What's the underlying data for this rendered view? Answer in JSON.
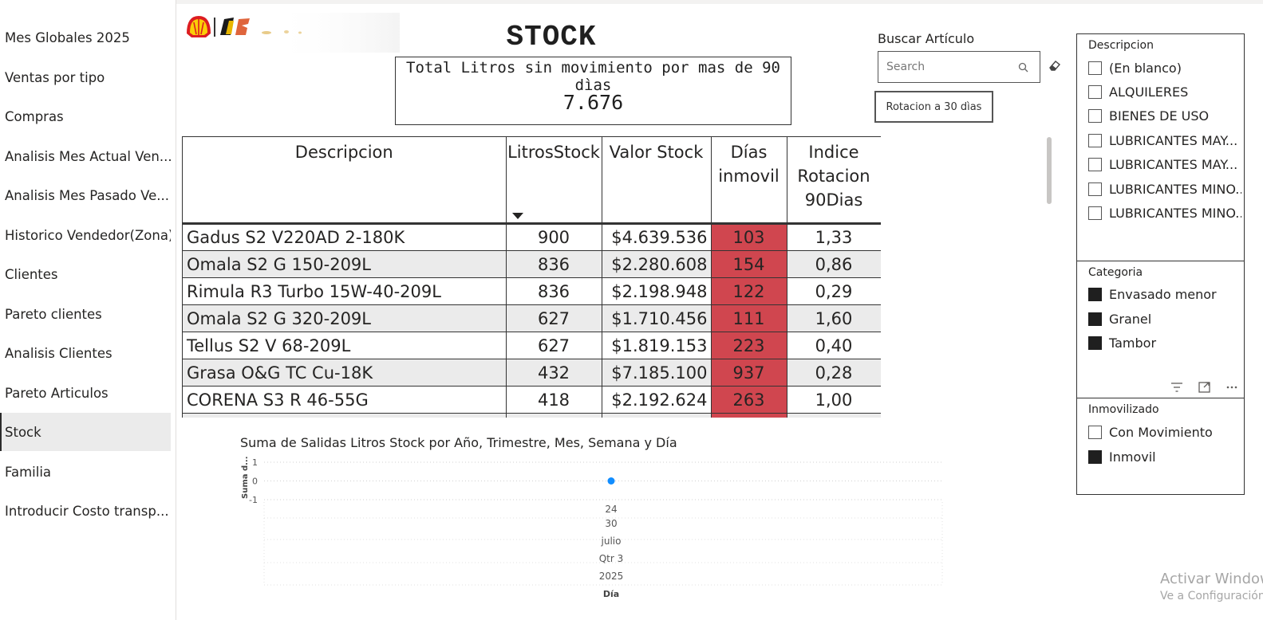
{
  "nav": {
    "items": [
      {
        "label": "Mes Globales 2025",
        "active": false
      },
      {
        "label": "Ventas por tipo",
        "active": false
      },
      {
        "label": "Compras",
        "active": false
      },
      {
        "label": "Analisis Mes Actual Ven...",
        "active": false
      },
      {
        "label": "Analisis Mes Pasado Ve...",
        "active": false
      },
      {
        "label": "Historico Vendedor(Zona)",
        "active": false
      },
      {
        "label": "Clientes",
        "active": false
      },
      {
        "label": "Pareto clientes",
        "active": false
      },
      {
        "label": "Analisis Clientes",
        "active": false
      },
      {
        "label": "Pareto Articulos",
        "active": false
      },
      {
        "label": "Stock",
        "active": true
      },
      {
        "label": "Familia",
        "active": false
      },
      {
        "label": "Introducir Costo transp...",
        "active": false
      }
    ]
  },
  "page": {
    "title": "STOCK"
  },
  "kpi": {
    "label": "Total Litros sin movimiento por mas de 90 dìas",
    "value": "7.676"
  },
  "search": {
    "title": "Buscar Artículo",
    "placeholder": "Search"
  },
  "rotation_button": {
    "label": "Rotacion a 30 dìas"
  },
  "table": {
    "headers": {
      "descripcion": "Descripcion",
      "litros": "LitrosStock",
      "valor": "Valor Stock",
      "dias": "Días inmovil",
      "indice": "Indice Rotacion 90Dias"
    },
    "rows": [
      {
        "descripcion": "Gadus S2 V220AD 2-180K",
        "litros": "900",
        "valor": "$4.639.536",
        "dias": "103",
        "indice": "1,33"
      },
      {
        "descripcion": "Omala S2 G 150-209L",
        "litros": "836",
        "valor": "$2.280.608",
        "dias": "154",
        "indice": "0,86"
      },
      {
        "descripcion": "Rimula R3 Turbo 15W-40-209L",
        "litros": "836",
        "valor": "$2.198.948",
        "dias": "122",
        "indice": "0,29"
      },
      {
        "descripcion": "Omala S2 G 320-209L",
        "litros": "627",
        "valor": "$1.710.456",
        "dias": "111",
        "indice": "1,60"
      },
      {
        "descripcion": "Tellus S2 V 68-209L",
        "litros": "627",
        "valor": "$1.819.153",
        "dias": "223",
        "indice": "0,40"
      },
      {
        "descripcion": "Grasa O&G TC Cu-18K",
        "litros": "432",
        "valor": "$7.185.100",
        "dias": "937",
        "indice": "0,28"
      },
      {
        "descripcion": "CORENA S3 R 46-55G",
        "litros": "418",
        "valor": "$2.192.624",
        "dias": "263",
        "indice": "1,00"
      }
    ],
    "highlight_color": "#d0464f"
  },
  "chart_data": {
    "type": "line",
    "title": "Suma de Salidas Litros Stock por Año, Trimestre, Mes, Semana y Día",
    "ylabel": "Suma d...",
    "xlabel": "Día",
    "yticks": [
      "1",
      "0",
      "-1"
    ],
    "ylim": [
      -1,
      1
    ],
    "x_levels": [
      "24",
      "30",
      "julio",
      "Qtr 3",
      "2025"
    ],
    "series": [
      {
        "x": [
          "24"
        ],
        "values": [
          0
        ]
      }
    ],
    "point_color": "#118dff",
    "grid": true
  },
  "slicers": {
    "descripcion": {
      "title": "Descripcion",
      "items": [
        {
          "label": "(En blanco)",
          "checked": false
        },
        {
          "label": "ALQUILERES",
          "checked": false
        },
        {
          "label": "BIENES DE USO",
          "checked": false
        },
        {
          "label": "LUBRICANTES MAY...",
          "checked": false
        },
        {
          "label": "LUBRICANTES MAY...",
          "checked": false
        },
        {
          "label": "LUBRICANTES MINO...",
          "checked": false
        },
        {
          "label": "LUBRICANTES MINO...",
          "checked": false
        }
      ]
    },
    "categoria": {
      "title": "Categoria",
      "items": [
        {
          "label": "Envasado menor",
          "checked": true
        },
        {
          "label": "Granel",
          "checked": true
        },
        {
          "label": "Tambor",
          "checked": true
        }
      ]
    },
    "inmovilizado": {
      "title": "Inmovilizado",
      "items": [
        {
          "label": "Con Movimiento",
          "checked": false
        },
        {
          "label": "Inmovil",
          "checked": true
        }
      ]
    }
  },
  "watermark": {
    "line1": "Activar Windows",
    "line2": "Ve a Configuración"
  },
  "icons": [
    "shell-logo-icon",
    "search-icon",
    "eraser-icon",
    "filter-icon",
    "focus-mode-icon",
    "more-options-icon"
  ]
}
